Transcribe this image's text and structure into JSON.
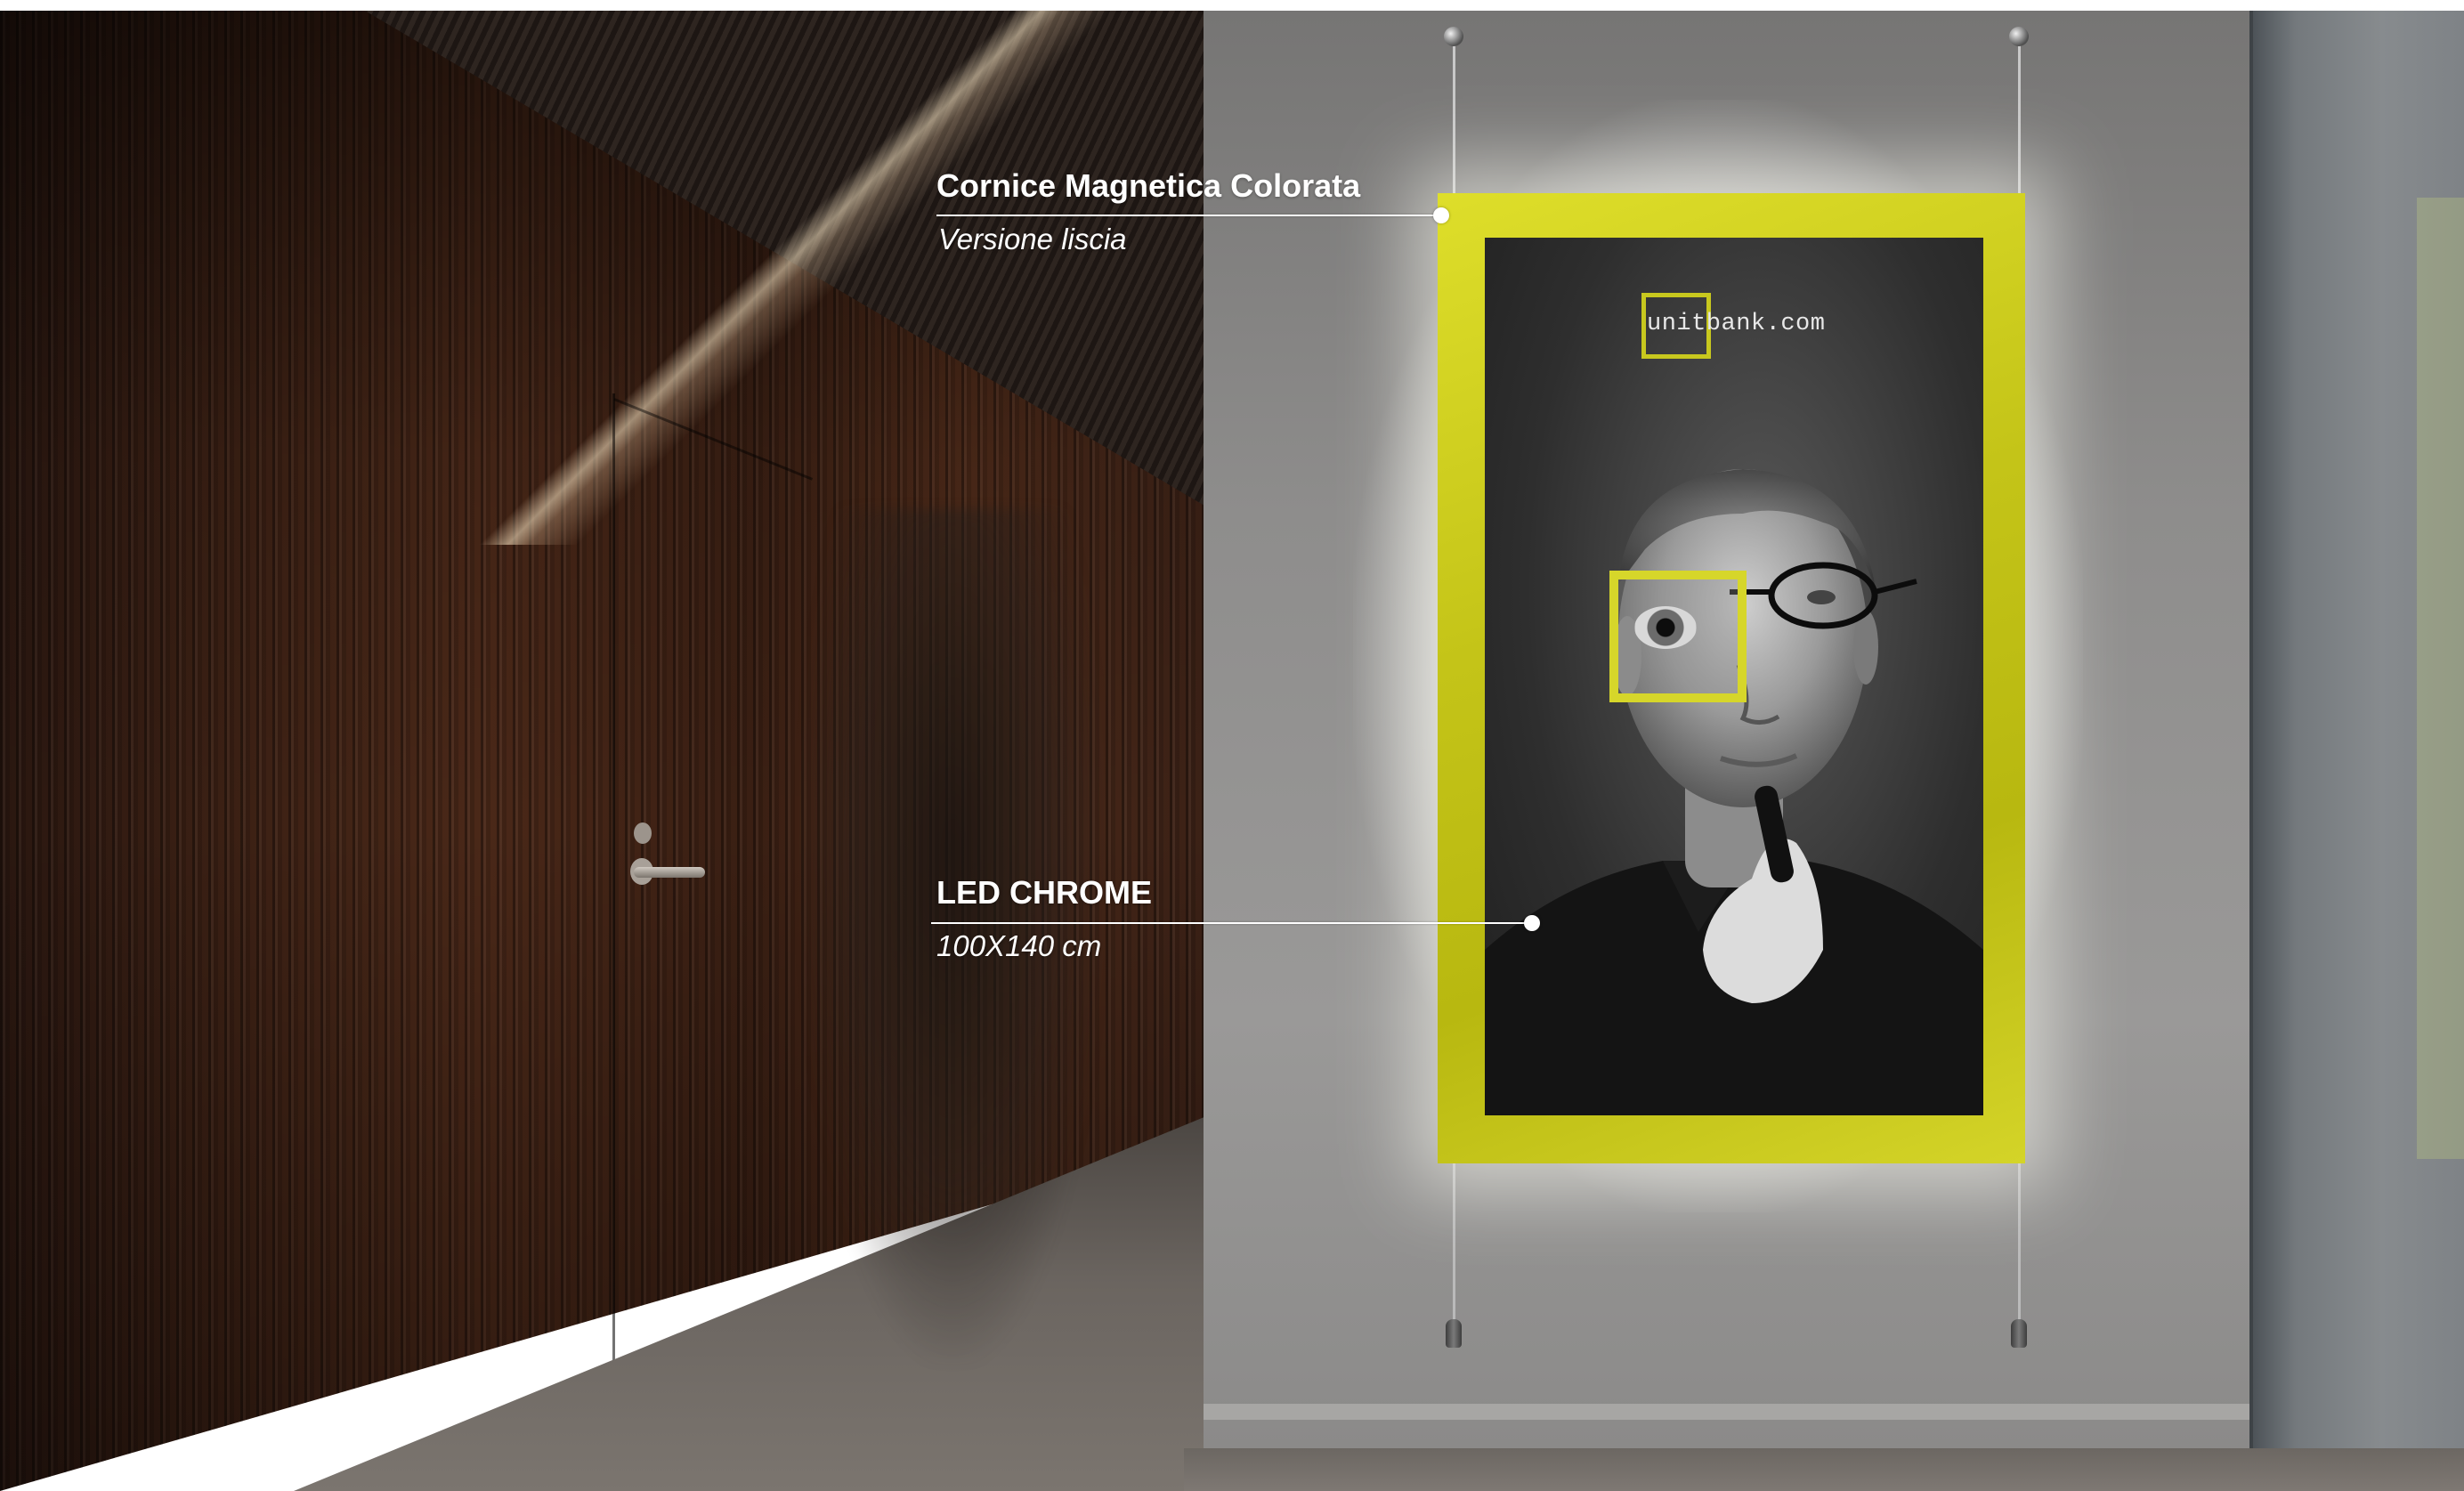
{
  "callouts": {
    "frame": {
      "title": "Cornice Magnetica Colorata",
      "subtitle": "Versione liscia"
    },
    "led": {
      "title": "LED CHROME",
      "subtitle": "100X140 cm"
    }
  },
  "poster": {
    "logo_text": "unitbank.com"
  },
  "colors": {
    "frame_accent": "#c8c81e",
    "callout_text": "#ffffff",
    "wood_wall": "#3b2014",
    "gallery_wall": "#8e8d8c"
  }
}
